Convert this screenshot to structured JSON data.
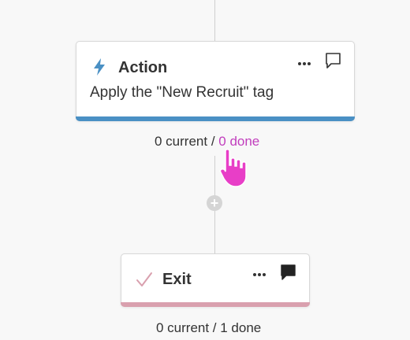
{
  "action_step": {
    "title": "Action",
    "description": "Apply the \"New Recruit\" tag",
    "counter_current": "0 current",
    "counter_separator": " / ",
    "counter_done": "0 done",
    "icon": "lightning-icon",
    "accent_color": "#4a90c4"
  },
  "exit_step": {
    "title": "Exit",
    "counter": "0 current / 1 done",
    "icon": "checkmark-icon",
    "accent_color": "#d9a0ae"
  },
  "add_step_symbol": "+",
  "more_symbol": "•••",
  "link_color": "#c13ebd"
}
